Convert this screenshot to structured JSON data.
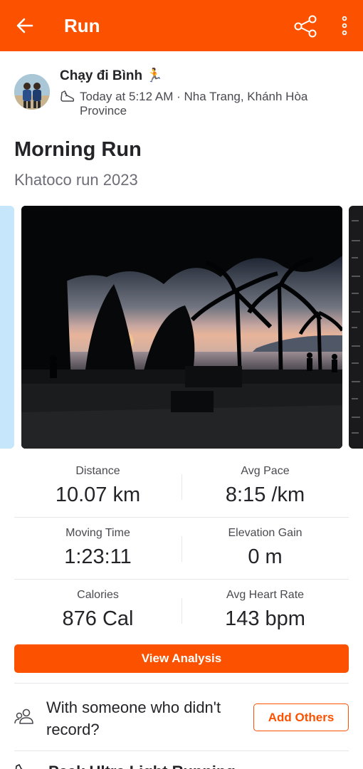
{
  "header": {
    "title": "Run"
  },
  "athlete": {
    "name": "Chạy đi Bình 🏃",
    "meta": "Today at 5:12 AM · Nha Trang, Khánh Hòa Province"
  },
  "activity": {
    "title": "Morning Run",
    "description": "Khatoco run 2023"
  },
  "stats": [
    {
      "label": "Distance",
      "value": "10.07 km"
    },
    {
      "label": "Avg Pace",
      "value": "8:15 /km"
    },
    {
      "label": "Moving Time",
      "value": "1:23:11"
    },
    {
      "label": "Elevation Gain",
      "value": "0 m"
    },
    {
      "label": "Calories",
      "value": "876 Cal"
    },
    {
      "label": "Avg Heart Rate",
      "value": "143 bpm"
    }
  ],
  "actions": {
    "view_analysis": "View Analysis",
    "with_someone": "With someone who didn't record?",
    "add_others": "Add Others"
  },
  "gear": {
    "label": "Peak Ultra Light Running"
  },
  "colors": {
    "brand": "#fc5200",
    "map": "#c6e6fb"
  },
  "icons": [
    "back-arrow-icon",
    "share-icon",
    "more-vertical-icon",
    "shoe-icon",
    "people-icon"
  ]
}
